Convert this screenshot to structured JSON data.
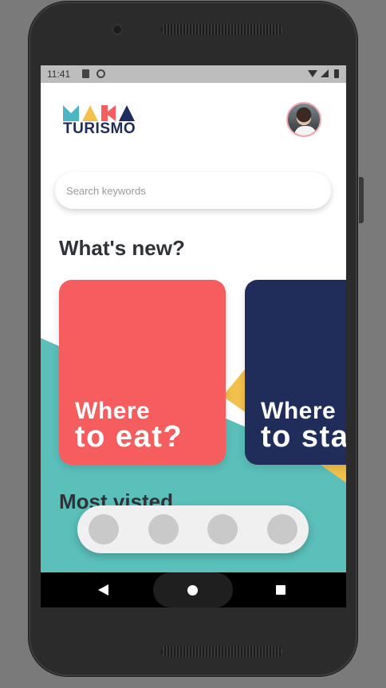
{
  "status_bar": {
    "time": "11:41"
  },
  "app": {
    "logo_text": "TURISMO",
    "logo_upper": "MAKA",
    "logo_colors": [
      "#4bb6c4",
      "#f2c04b",
      "#f55d5e",
      "#1f2b5c"
    ]
  },
  "search": {
    "placeholder": "Search keywords",
    "value": ""
  },
  "sections": {
    "whats_new": "What's new?",
    "most_visited": "Most visted"
  },
  "cards": [
    {
      "line1": "Where",
      "line2": "to eat?",
      "color": "#f55d5e"
    },
    {
      "line1": "Where",
      "line2": "to stay?",
      "color": "#202c5a"
    }
  ],
  "bottom_nav": {
    "items": 4
  },
  "colors": {
    "teal": "#5bbfba",
    "yellow": "#f2c04b",
    "text": "#2f3338"
  }
}
